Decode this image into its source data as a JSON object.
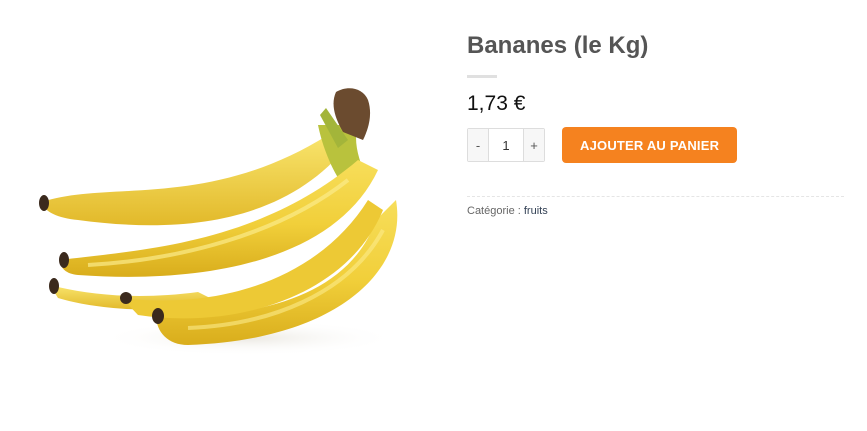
{
  "product": {
    "image_alt": "banana-bunch-image",
    "title": "Bananes (le Kg)",
    "price": "1,73 €",
    "quantity": {
      "minus_label": "-",
      "value": "1",
      "plus_label": "+"
    },
    "add_to_cart_label": "AJOUTER AU PANIER",
    "category_label": "Catégorie :",
    "category_link": "fruits"
  },
  "colors": {
    "accent": "#f5821f",
    "title": "#555555",
    "price": "#111111"
  }
}
